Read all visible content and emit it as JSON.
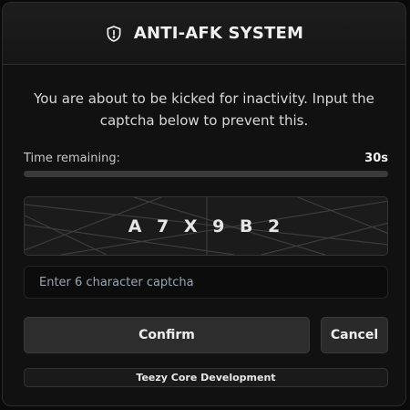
{
  "header": {
    "title": "ANTI-AFK SYSTEM",
    "icon": "shield-alert-icon"
  },
  "message": "You are about to be kicked for inactivity. Input the captcha below to prevent this.",
  "timer": {
    "label": "Time remaining:",
    "value": "30s",
    "progress_fraction": 1.0
  },
  "captcha": {
    "code": "A 7 X 9 B 2"
  },
  "input": {
    "placeholder": "Enter 6 character captcha",
    "value": ""
  },
  "buttons": {
    "confirm": "Confirm",
    "cancel": "Cancel"
  },
  "footer": "Teezy Core Development"
}
